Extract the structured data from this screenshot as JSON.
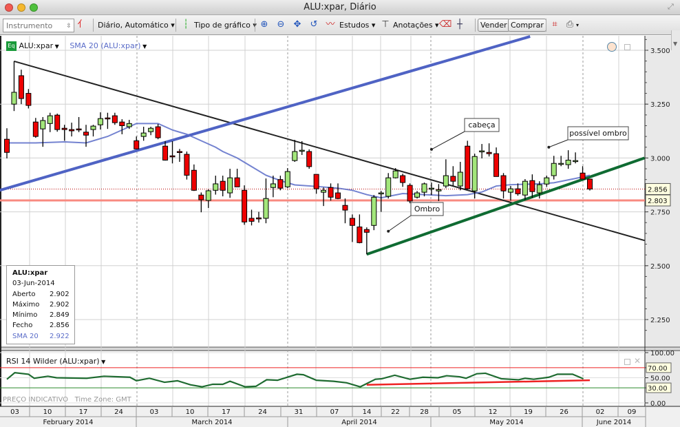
{
  "window": {
    "title": "ALU:xpar, Diário"
  },
  "toolbar": {
    "instrument_placeholder": "Instrumento",
    "period": "Diário,  Automático",
    "chart_type": "Tipo de gráfico",
    "studies": "Estudos",
    "annotations": "Anotações",
    "sell": "Vender",
    "buy": "Comprar"
  },
  "legend": {
    "symbol": "ALU:xpar",
    "sma": "SMA 20 (ALU:xpar)",
    "eq_badge": "Eq"
  },
  "infobox": {
    "symbol": "ALU:xpar",
    "date": "03-Jun-2014",
    "rows": [
      {
        "k": "Aberto",
        "v": "2.902"
      },
      {
        "k": "Máximo",
        "v": "2.902"
      },
      {
        "k": "Mínimo",
        "v": "2.849"
      },
      {
        "k": "Fecho",
        "v": "2.856"
      },
      {
        "k": "SMA 20",
        "v": "2.922"
      }
    ]
  },
  "rsi_panel": {
    "label": "RSI 14 Wilder (ALU:xpar)"
  },
  "footer": {
    "price_note": "PREÇO INDICATIVO",
    "timezone": "Time Zone: GMT"
  },
  "colors": {
    "up": "#a3e67b",
    "down": "#ee0000",
    "sma": "#5a6cc8",
    "trend_blue": "#4f63c4",
    "trend_green": "#0f6b32",
    "support": "#f88a80",
    "rsi": "#1e6b30"
  },
  "chart_data": {
    "type": "candlestick",
    "price_axis": {
      "ylim": [
        2.15,
        3.56
      ],
      "ticks": [
        "3.500",
        "3.250",
        "3.000",
        "2.750",
        "2.500",
        "2.250"
      ],
      "tick_values": [
        3.5,
        3.25,
        3.0,
        2.75,
        2.5,
        2.25
      ]
    },
    "last_price_label": "2.856",
    "last_price": 2.856,
    "support_label": "2.803",
    "support": 2.803,
    "x_day_labels": [
      "03",
      "10",
      "17",
      "24",
      "03",
      "10",
      "17",
      "24",
      "31",
      "07",
      "14",
      "22",
      "28",
      "05",
      "12",
      "19",
      "26",
      "02",
      "09"
    ],
    "x_month_labels": [
      "February 2014",
      "March 2014",
      "April 2014",
      "May 2014",
      "June 2014"
    ],
    "candles": [
      [
        3.087,
        3.138,
        2.998,
        3.026
      ],
      [
        3.25,
        3.449,
        3.218,
        3.305
      ],
      [
        3.382,
        3.41,
        3.25,
        3.276
      ],
      [
        3.3,
        3.32,
        3.23,
        3.244
      ],
      [
        3.167,
        3.186,
        3.094,
        3.1
      ],
      [
        3.135,
        3.19,
        3.052,
        3.174
      ],
      [
        3.16,
        3.21,
        3.12,
        3.196
      ],
      [
        3.199,
        3.206,
        3.122,
        3.132
      ],
      [
        3.138,
        3.154,
        3.08,
        3.132
      ],
      [
        3.132,
        3.164,
        3.1,
        3.126
      ],
      [
        3.135,
        3.19,
        3.12,
        3.132
      ],
      [
        3.12,
        3.154,
        3.052,
        3.106
      ],
      [
        3.132,
        3.154,
        3.1,
        3.148
      ],
      [
        3.154,
        3.212,
        3.132,
        3.183
      ],
      [
        3.186,
        3.21,
        3.135,
        3.183
      ],
      [
        3.196,
        3.21,
        3.154,
        3.164
      ],
      [
        3.167,
        3.18,
        3.11,
        3.15
      ],
      [
        3.145,
        3.177,
        3.135,
        3.16
      ],
      [
        3.08,
        3.1,
        3.04,
        3.042
      ],
      [
        3.1,
        3.145,
        3.08,
        3.116
      ],
      [
        3.122,
        3.145,
        3.106,
        3.138
      ],
      [
        3.145,
        3.158,
        3.087,
        3.094
      ],
      [
        3.055,
        3.078,
        2.988,
        2.99
      ],
      [
        3.01,
        3.078,
        2.975,
        3.008
      ],
      [
        3.03,
        3.042,
        2.982,
        3.026
      ],
      [
        3.017,
        3.03,
        2.9,
        2.92
      ],
      [
        2.943,
        2.97,
        2.847,
        2.85
      ],
      [
        2.828,
        2.84,
        2.748,
        2.806
      ],
      [
        2.803,
        2.854,
        2.768,
        2.848
      ],
      [
        2.85,
        2.918,
        2.83,
        2.88
      ],
      [
        2.892,
        2.918,
        2.822,
        2.85
      ],
      [
        2.838,
        2.95,
        2.815,
        2.908
      ],
      [
        2.908,
        2.95,
        2.866,
        2.866
      ],
      [
        2.85,
        2.873,
        2.69,
        2.703
      ],
      [
        2.72,
        2.76,
        2.687,
        2.706
      ],
      [
        2.722,
        2.75,
        2.7,
        2.72
      ],
      [
        2.72,
        2.905,
        2.697,
        2.812
      ],
      [
        2.863,
        2.918,
        2.818,
        2.88
      ],
      [
        2.9,
        2.918,
        2.85,
        2.86
      ],
      [
        2.866,
        2.953,
        2.86,
        2.937
      ],
      [
        2.988,
        3.084,
        2.982,
        3.03
      ],
      [
        3.036,
        3.078,
        3.014,
        3.036
      ],
      [
        3.03,
        3.04,
        2.95,
        2.96
      ],
      [
        2.924,
        2.924,
        2.834,
        2.857
      ],
      [
        2.841,
        2.863,
        2.777,
        2.85
      ],
      [
        2.863,
        2.882,
        2.802,
        2.818
      ],
      [
        2.838,
        2.882,
        2.809,
        2.812
      ],
      [
        2.78,
        2.812,
        2.697,
        2.758
      ],
      [
        2.72,
        2.738,
        2.61,
        2.687
      ],
      [
        2.68,
        2.738,
        2.604,
        2.607
      ],
      [
        2.668,
        2.678,
        2.553,
        2.655
      ],
      [
        2.687,
        2.828,
        2.665,
        2.818
      ],
      [
        2.838,
        2.847,
        2.75,
        2.838
      ],
      [
        2.822,
        2.93,
        2.812,
        2.908
      ],
      [
        2.908,
        2.953,
        2.905,
        2.94
      ],
      [
        2.918,
        2.927,
        2.866,
        2.886
      ],
      [
        2.873,
        2.882,
        2.79,
        2.8
      ],
      [
        2.818,
        2.847,
        2.812,
        2.838
      ],
      [
        2.841,
        2.886,
        2.822,
        2.88
      ],
      [
        2.86,
        2.886,
        2.828,
        2.86
      ],
      [
        2.847,
        2.879,
        2.8,
        2.853
      ],
      [
        2.87,
        2.994,
        2.86,
        2.918
      ],
      [
        2.915,
        2.962,
        2.87,
        2.892
      ],
      [
        2.87,
        2.982,
        2.85,
        2.934
      ],
      [
        3.055,
        3.08,
        2.854,
        2.857
      ],
      [
        2.847,
        3.02,
        2.812,
        3.007
      ],
      [
        3.033,
        3.065,
        2.998,
        3.033
      ],
      [
        3.026,
        3.068,
        3.007,
        3.02
      ],
      [
        3.02,
        3.049,
        2.914,
        2.914
      ],
      [
        2.918,
        2.93,
        2.812,
        2.847
      ],
      [
        2.841,
        2.87,
        2.802,
        2.857
      ],
      [
        2.857,
        2.882,
        2.825,
        2.834
      ],
      [
        2.828,
        2.902,
        2.806,
        2.892
      ],
      [
        2.895,
        2.924,
        2.815,
        2.844
      ],
      [
        2.838,
        2.892,
        2.812,
        2.876
      ],
      [
        2.879,
        2.918,
        2.866,
        2.908
      ],
      [
        2.918,
        3.01,
        2.9,
        2.975
      ],
      [
        2.975,
        3.01,
        2.962,
        2.975
      ],
      [
        2.969,
        3.036,
        2.95,
        2.99
      ],
      [
        2.988,
        3.026,
        2.975,
        2.988
      ],
      [
        2.93,
        2.962,
        2.902,
        2.902
      ],
      [
        2.902,
        2.902,
        2.849,
        2.856
      ]
    ],
    "sma20": [
      [
        0,
        3.07
      ],
      [
        4,
        3.07
      ],
      [
        8,
        3.075
      ],
      [
        11,
        3.07
      ],
      [
        14,
        3.1
      ],
      [
        18,
        3.16
      ],
      [
        21,
        3.16
      ],
      [
        23,
        3.13
      ],
      [
        25,
        3.11
      ],
      [
        27,
        3.08
      ],
      [
        29,
        3.05
      ],
      [
        30,
        3.03
      ],
      [
        32,
        3.0
      ],
      [
        34,
        2.96
      ],
      [
        36,
        2.92
      ],
      [
        38,
        2.895
      ],
      [
        40,
        2.875
      ],
      [
        43,
        2.868
      ],
      [
        46,
        2.86
      ],
      [
        48,
        2.85
      ],
      [
        50,
        2.83
      ],
      [
        52,
        2.815
      ],
      [
        55,
        2.835
      ],
      [
        58,
        2.83
      ],
      [
        61,
        2.825
      ],
      [
        64,
        2.83
      ],
      [
        66,
        2.842
      ],
      [
        68,
        2.87
      ],
      [
        70,
        2.876
      ],
      [
        74,
        2.88
      ],
      [
        76,
        2.885
      ],
      [
        79,
        2.905
      ],
      [
        81,
        2.92
      ]
    ],
    "rsi14": [
      [
        0,
        47
      ],
      [
        1.1,
        60
      ],
      [
        3,
        57
      ],
      [
        3.8,
        49
      ],
      [
        5.7,
        53
      ],
      [
        6.9,
        50
      ],
      [
        11.1,
        49
      ],
      [
        13.5,
        53
      ],
      [
        17.1,
        51
      ],
      [
        18,
        44
      ],
      [
        19.8,
        49
      ],
      [
        21.9,
        41
      ],
      [
        23.7,
        44
      ],
      [
        25.5,
        36
      ],
      [
        27.1,
        32
      ],
      [
        28.6,
        37
      ],
      [
        30,
        37
      ],
      [
        31,
        43
      ],
      [
        33.1,
        32
      ],
      [
        34.6,
        33
      ],
      [
        36.1,
        46
      ],
      [
        37.6,
        45
      ],
      [
        40.3,
        57
      ],
      [
        41.2,
        56
      ],
      [
        43,
        45
      ],
      [
        45.4,
        43
      ],
      [
        47.2,
        40
      ],
      [
        49.1,
        32
      ],
      [
        51.2,
        47
      ],
      [
        52.1,
        48
      ],
      [
        53.9,
        55
      ],
      [
        56,
        47
      ],
      [
        57.8,
        51
      ],
      [
        59.9,
        50
      ],
      [
        61.1,
        54
      ],
      [
        62.9,
        52
      ],
      [
        63.8,
        49
      ],
      [
        65.3,
        58
      ],
      [
        66.5,
        59
      ],
      [
        68.7,
        48
      ],
      [
        71.1,
        46
      ],
      [
        72,
        49
      ],
      [
        73.2,
        47
      ],
      [
        75.3,
        51
      ],
      [
        76.5,
        57
      ],
      [
        78.6,
        57
      ],
      [
        80.1,
        48
      ]
    ],
    "rsi_axis": {
      "ticks": [
        "100.00",
        "70.00",
        "50.00",
        "30.00",
        "0.00"
      ],
      "tick_values": [
        100,
        70,
        50,
        30,
        0
      ],
      "bands": [
        70,
        30
      ]
    },
    "trendlines": [
      {
        "name": "black-resistance",
        "from": [
          1,
          3.449
        ],
        "to": [
          88.6,
          2.617
        ]
      },
      {
        "name": "blue-uptrend",
        "from": [
          -1,
          2.85
        ],
        "to": [
          72.7,
          3.564
        ]
      },
      {
        "name": "green-neckline",
        "from": [
          50,
          2.553
        ],
        "to": [
          88.6,
          3.0
        ]
      }
    ],
    "rsi_trendline": {
      "from": [
        50,
        36
      ],
      "to": [
        81,
        45
      ]
    },
    "annotations": [
      {
        "text": "cabeça",
        "anchor": [
          59,
          3.04
        ]
      },
      {
        "text": "Ombro",
        "anchor": [
          53,
          2.66
        ]
      },
      {
        "text": "possível ombro",
        "anchor": [
          75.3,
          3.05
        ]
      }
    ]
  }
}
